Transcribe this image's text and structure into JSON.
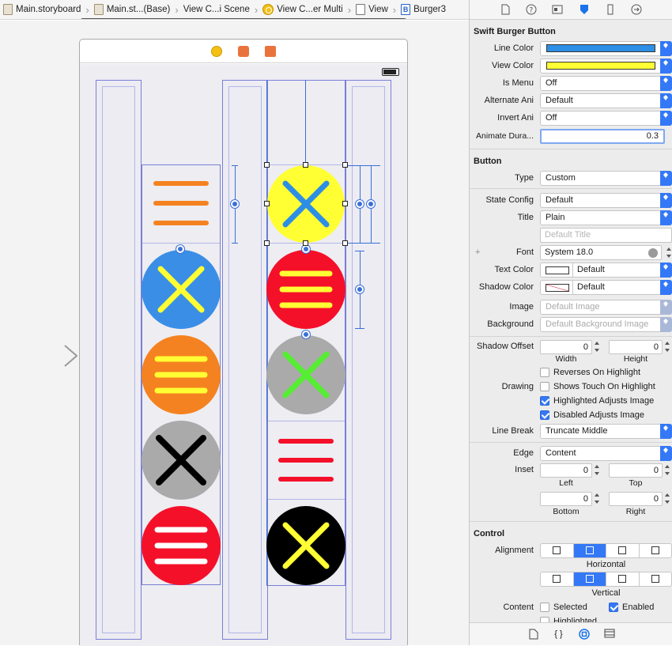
{
  "breadcrumbs": [
    {
      "label": "Main.storyboard",
      "icon": "storyboard-file-icon"
    },
    {
      "label": "Main.st...(Base)",
      "icon": "storyboard-file-icon"
    },
    {
      "label": "View C...i Scene",
      "icon": "scene-icon"
    },
    {
      "label": "View C...er Multi",
      "icon": "view-controller-icon"
    },
    {
      "label": "View",
      "icon": "view-icon"
    },
    {
      "label": "Burger3",
      "icon": "button-b-icon"
    }
  ],
  "inspector_tabs": [
    "file-inspector-icon",
    "quick-help-icon",
    "identity-inspector-icon",
    "attributes-inspector-icon",
    "size-inspector-icon",
    "connections-inspector-icon"
  ],
  "swift_burger": {
    "title": "Swift Burger Button",
    "line_color_label": "Line Color",
    "line_color": "#2d8ee6",
    "view_color_label": "View Color",
    "view_color": "#ffff33",
    "is_menu_label": "Is Menu",
    "is_menu": "Off",
    "alternate_label": "Alternate Ani",
    "alternate": "Default",
    "invert_label": "Invert Ani",
    "invert": "Off",
    "animate_label": "Animate Dura...",
    "animate": "0.3"
  },
  "button": {
    "title": "Button",
    "type_label": "Type",
    "type": "Custom",
    "state_label": "State Config",
    "state": "Default",
    "title_label": "Title",
    "title_value": "Plain",
    "default_title_placeholder": "Default Title",
    "font_label": "Font",
    "font": "System 18.0",
    "text_color_label": "Text Color",
    "text_color": "Default",
    "shadow_color_label": "Shadow Color",
    "shadow_color": "Default",
    "image_label": "Image",
    "image_placeholder": "Default Image",
    "background_label": "Background",
    "background_placeholder": "Default Background Image",
    "shadow_offset_label": "Shadow Offset",
    "shadow_w": "0",
    "shadow_h": "0",
    "width_label": "Width",
    "height_label": "Height",
    "reverses": "Reverses On Highlight",
    "drawing_label": "Drawing",
    "shows_touch": "Shows Touch On Highlight",
    "highlighted_adj": "Highlighted Adjusts Image",
    "disabled_adj": "Disabled Adjusts Image",
    "line_break_label": "Line Break",
    "line_break": "Truncate Middle",
    "edge_label": "Edge",
    "edge": "Content",
    "inset_label": "Inset",
    "left": "0",
    "top": "0",
    "bottom": "0",
    "right": "0",
    "left_label": "Left",
    "top_label": "Top",
    "bottom_label": "Bottom",
    "right_label": "Right"
  },
  "control": {
    "title": "Control",
    "alignment_label": "Alignment",
    "horizontal_label": "Horizontal",
    "vertical_label": "Vertical",
    "content_label": "Content",
    "selected": "Selected",
    "enabled": "Enabled",
    "highlighted": "Highlighted"
  },
  "bottom_tabs": [
    "file-template-icon",
    "code-snippet-icon",
    "object-library-icon",
    "media-library-icon"
  ],
  "bottom_tab_glyph": "{ }"
}
